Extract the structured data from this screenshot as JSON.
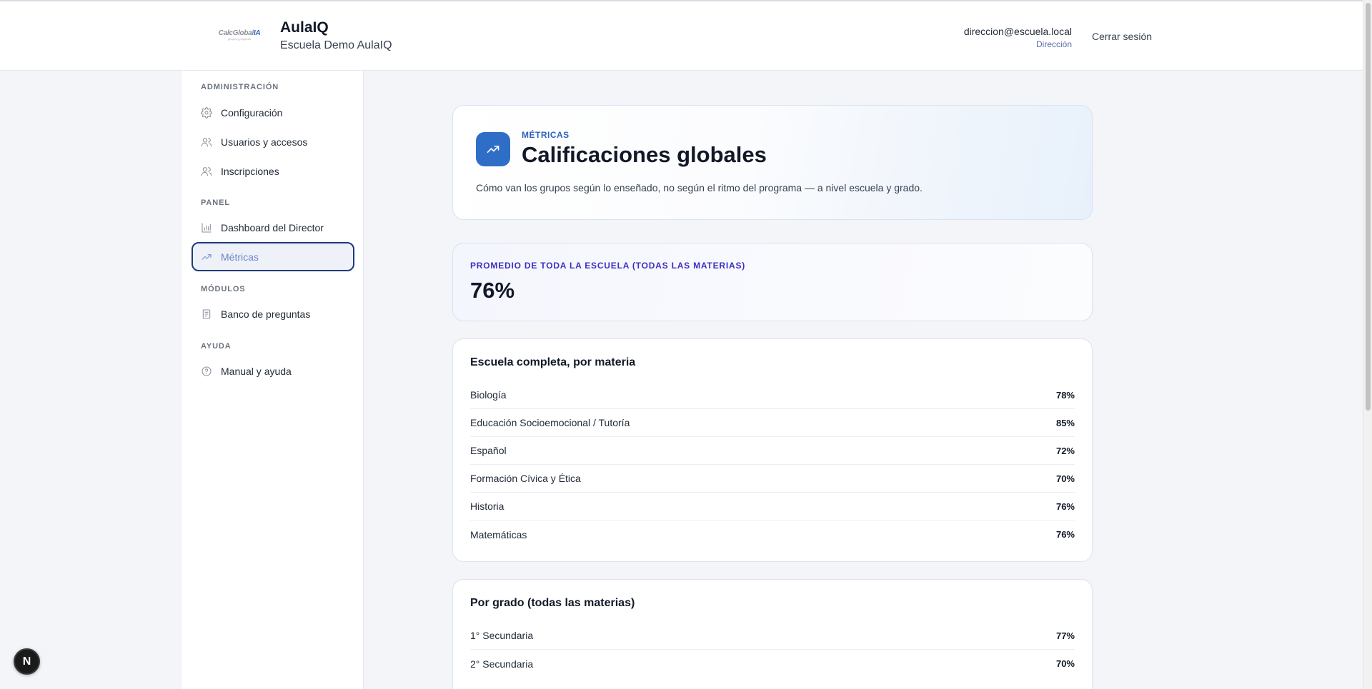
{
  "header": {
    "logo_word_main": "CalcGlobal",
    "logo_word_accent": "IA",
    "logo_tagline": "grupos y progreso",
    "title": "AulaIQ",
    "subtitle": "Escuela Demo AulaIQ",
    "user_email": "direccion@escuela.local",
    "user_role": "Dirección",
    "logout_label": "Cerrar sesión"
  },
  "sidebar": {
    "sections": [
      {
        "label": "ADMINISTRACIÓN"
      },
      {
        "label": "PANEL"
      },
      {
        "label": "MÓDULOS"
      },
      {
        "label": "AYUDA"
      }
    ],
    "items": [
      {
        "label": "Configuración",
        "icon": "gear-icon"
      },
      {
        "label": "Usuarios y accesos",
        "icon": "users-icon"
      },
      {
        "label": "Inscripciones",
        "icon": "users-icon"
      },
      {
        "label": "Dashboard del Director",
        "icon": "bar-chart-icon"
      },
      {
        "label": "Métricas",
        "icon": "trending-up-icon",
        "active": true
      },
      {
        "label": "Banco de preguntas",
        "icon": "document-icon"
      },
      {
        "label": "Manual y ayuda",
        "icon": "help-circle-icon"
      }
    ]
  },
  "hero": {
    "kicker": "MÉTRICAS",
    "title": "Calificaciones globales",
    "description": "Cómo van los grupos según lo enseñado, no según el ritmo del programa — a nivel escuela y grado."
  },
  "average": {
    "label": "PROMEDIO DE TODA LA ESCUELA (TODAS LAS MATERIAS)",
    "value": "76%"
  },
  "by_subject": {
    "title": "Escuela completa, por materia",
    "rows": [
      {
        "name": "Biología",
        "value": "78%"
      },
      {
        "name": "Educación Socioemocional / Tutoría",
        "value": "85%"
      },
      {
        "name": "Español",
        "value": "72%"
      },
      {
        "name": "Formación Cívica y Ética",
        "value": "70%"
      },
      {
        "name": "Historia",
        "value": "76%"
      },
      {
        "name": "Matemáticas",
        "value": "76%"
      }
    ]
  },
  "by_grade": {
    "title": "Por grado (todas las materias)",
    "rows": [
      {
        "name": "1° Secundaria",
        "value": "77%"
      },
      {
        "name": "2° Secundaria",
        "value": "70%"
      }
    ]
  },
  "dev_badge": "N",
  "colors": {
    "accent": "#2f6ec7",
    "active_border": "#1e3a7a",
    "avg_label": "#3b2fc0"
  }
}
